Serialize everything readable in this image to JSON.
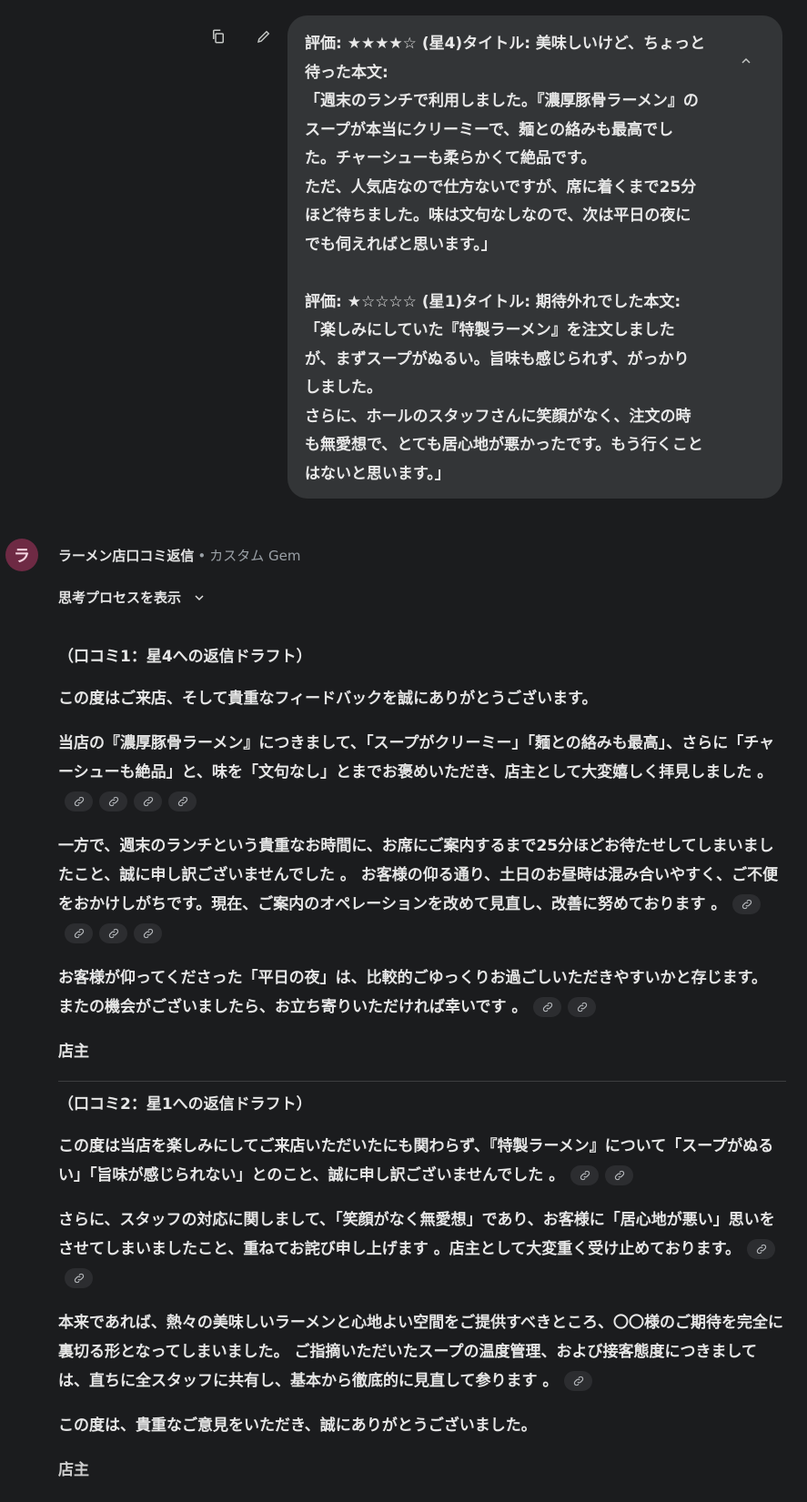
{
  "user_message": {
    "lines": [
      "評価: ★★★★☆ (星4)タイトル: 美味しいけど、ちょっと",
      "待った本文:",
      "「週末のランチで利用しました。『濃厚豚骨ラーメン』の",
      "スープが本当にクリーミーで、麺との絡みも最高でし",
      "た。チャーシューも柔らかくて絶品です。",
      "ただ、人気店なので仕方ないですが、席に着くまで25分",
      "ほど待ちました。味は文句なしなので、次は平日の夜に",
      "でも伺えればと思います。」",
      "",
      "評価: ★☆☆☆☆ (星1)タイトル: 期待外れでした本文:",
      "「楽しみにしていた『特製ラーメン』を注文しました",
      "が、まずスープがぬるい。旨味も感じられず、がっかり",
      "しました。",
      "さらに、ホールのスタッフさんに笑顔がなく、注文の時",
      "も無愛想で、とても居心地が悪かったです。もう行くこと",
      "はないと思います。」"
    ],
    "icons": {
      "copy": "copy-icon",
      "edit": "pencil-icon",
      "collapse": "chevron-up-icon"
    }
  },
  "gem": {
    "avatar_letter": "ラ",
    "name": "ラーメン店口コミ返信",
    "separator": "•",
    "subtitle": "カスタム Gem",
    "avatar_color": "#6e2a44"
  },
  "thinking_toggle": {
    "label": "思考プロセスを表示"
  },
  "response": {
    "draft1_heading": "（口コミ1：星4への返信ドラフト）",
    "draft1_p1": "この度はご来店、そして貴重なフィードバックを誠にありがとうございます。",
    "draft1_p2": "当店の『濃厚豚骨ラーメン』につきまして、「スープがクリーミー」「麺との絡みも最高」、さらに「チャーシューも絶品」と、味を「文句なし」とまでお褒めいただき、店主として大変嬉しく拝見しました 。",
    "draft1_p3": "一方で、週末のランチという貴重なお時間に、お席にご案内するまで25分ほどお待たせしてしまいましたこと、誠に申し訳ございませんでした 。 お客様の仰る通り、土日のお昼時は混み合いやすく、ご不便をおかけしがちです。現在、ご案内のオペレーションを改めて見直し、改善に努めております 。",
    "draft1_p4": "お客様が仰ってくださった「平日の夜」は、比較的ごゆっくりお過ごしいただきやすいかと存じます。 またの機会がございましたら、お立ち寄りいただければ幸いです 。",
    "draft1_sign": "店主",
    "draft2_heading": "（口コミ2：星1への返信ドラフト）",
    "draft2_p1": "この度は当店を楽しみにしてご来店いただいたにも関わらず、『特製ラーメン』について「スープがぬるい」「旨味が感じられない」とのこと、誠に申し訳ございませんでした 。",
    "draft2_p2": "さらに、スタッフの対応に関しまして、「笑顔がなく無愛想」であり、お客様に「居心地が悪い」思いをさせてしまいましたこと、重ねてお詫び申し上げます 。店主として大変重く受け止めております。",
    "draft2_p3": "本来であれば、熱々の美味しいラーメンと心地よい空間をご提供すべきところ、〇〇様のご期待を完全に裏切る形となってしまいました。 ご指摘いただいたスープの温度管理、および接客態度につきましては、直ちに全スタッフに共有し、基本から徹底的に見直して参ります 。",
    "draft2_p4": "この度は、貴重なご意見をいただき、誠にありがとうございました。",
    "draft2_sign": "店主",
    "citation_icon": "link-icon"
  }
}
